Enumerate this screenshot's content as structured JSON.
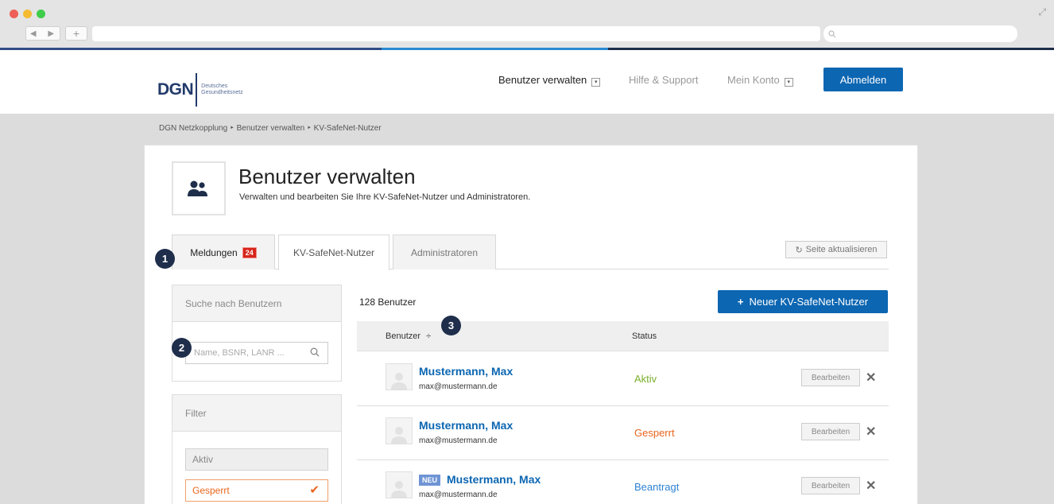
{
  "browser": {
    "back_forward": "◀ ▶",
    "new_tab": "+",
    "search_icon": "search-icon"
  },
  "header": {
    "logo": {
      "abbr": "DGN",
      "line1": "Deutsches",
      "line2": "Gesundheitsnetz"
    },
    "nav": [
      {
        "label": "Benutzer verwalten",
        "active": true
      },
      {
        "label": "Hilfe & Support"
      },
      {
        "label": "Mein Konto"
      }
    ],
    "logout": "Abmelden"
  },
  "breadcrumb": "DGN Netzkopplung ‣ Benutzer verwalten ‣ KV-SafeNet-Nutzer",
  "page": {
    "title": "Benutzer verwalten",
    "subtitle": "Verwalten und bearbeiten Sie Ihre KV-SafeNet-Nutzer und Administratoren."
  },
  "tabs": [
    {
      "label": "Meldungen",
      "badge": "24"
    },
    {
      "label": "KV-SafeNet-Nutzer",
      "active": true
    },
    {
      "label": "Administratoren"
    }
  ],
  "refresh_label": "Seite aktualisieren",
  "markers": [
    "1",
    "2",
    "3"
  ],
  "search": {
    "heading": "Suche nach Benutzern",
    "placeholder": "Name, BSNR, LANR ..."
  },
  "filter": {
    "heading": "Filter",
    "options": [
      {
        "label": "Aktiv",
        "selected": false
      },
      {
        "label": "Gesperrt",
        "selected": true
      }
    ]
  },
  "users": {
    "count": "128 Benutzer",
    "new_button": "Neuer KV-SafeNet-Nutzer",
    "columns": {
      "user": "Benutzer",
      "status": "Status"
    },
    "rows": [
      {
        "name": "Mustermann, Max",
        "email": "max@mustermann.de",
        "status": "Aktiv",
        "status_color": "#7bb02e",
        "new": false
      },
      {
        "name": "Mustermann, Max",
        "email": "max@mustermann.de",
        "status": "Gesperrt",
        "status_color": "#e8661e",
        "new": false
      },
      {
        "name": "Mustermann, Max",
        "email": "max@mustermann.de",
        "status": "Beantragt",
        "status_color": "#2d82d2",
        "new": true,
        "badge": "NEU"
      }
    ],
    "edit_label": "Bearbeiten"
  },
  "colors": {
    "primary": "#0c66b2",
    "brand": "#223a6b",
    "alert": "#d7261b"
  }
}
